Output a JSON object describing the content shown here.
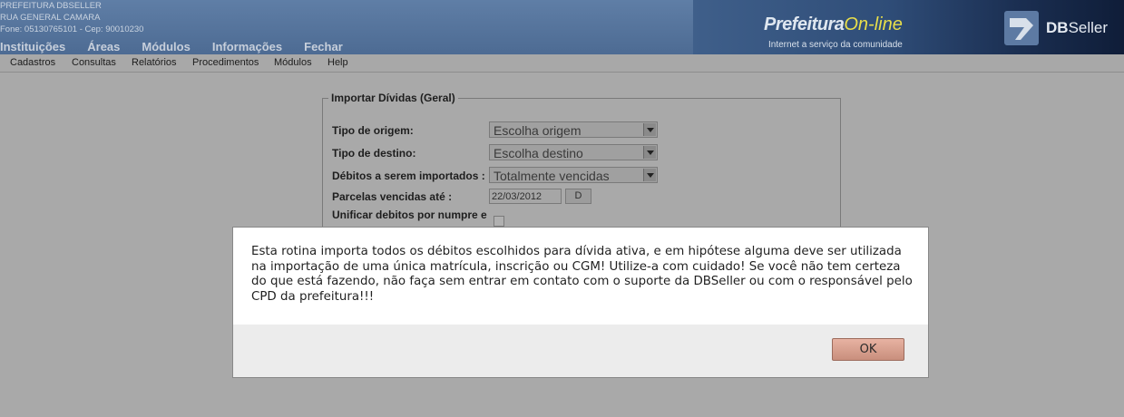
{
  "header": {
    "org_name": "PREFEITURA DBSELLER",
    "org_address": "RUA GENERAL CAMARA",
    "org_contact": "Fone: 05130765101  -  Cep: 90010230",
    "top_nav": [
      "Instituições",
      "Áreas",
      "Módulos",
      "Informações",
      "Fechar"
    ],
    "logo_part1": "Prefeitura",
    "logo_part2": "On-line",
    "logo_tagline": "Internet a serviço da comunidade",
    "brand_db": "DB",
    "brand_seller": "Seller"
  },
  "menubar": {
    "items": [
      "Cadastros",
      "Consultas",
      "Relatórios",
      "Procedimentos",
      "Módulos",
      "Help"
    ]
  },
  "form": {
    "legend": "Importar Dívidas (Geral)",
    "tipo_origem_label": "Tipo de origem:",
    "tipo_origem_value": "Escolha origem",
    "tipo_destino_label": "Tipo de destino:",
    "tipo_destino_value": "Escolha destino",
    "debitos_label": "Débitos a serem importados :",
    "debitos_value": "Totalmente vencidas",
    "parcelas_label": "Parcelas vencidas até :",
    "parcelas_value": "22/03/2012",
    "date_button": "D",
    "unificar_label": "Unificar debitos por numpre e"
  },
  "modal": {
    "message": "Esta rotina importa todos os débitos escolhidos para dívida ativa, e em hipótese alguma deve ser utilizada na importação de uma única matrícula, inscrição ou CGM! Utilize-a com cuidado! Se você não tem certeza do que está fazendo, não faça sem entrar em contato com o suporte da DBSeller ou com o responsável pelo CPD da prefeitura!!!",
    "ok_label": "OK"
  },
  "colors": {
    "header_bg": "#5a799f",
    "overlay_bg": "#a9a9a9",
    "ok_button": "#d9a08e",
    "logo_accent": "#e9df4a"
  }
}
